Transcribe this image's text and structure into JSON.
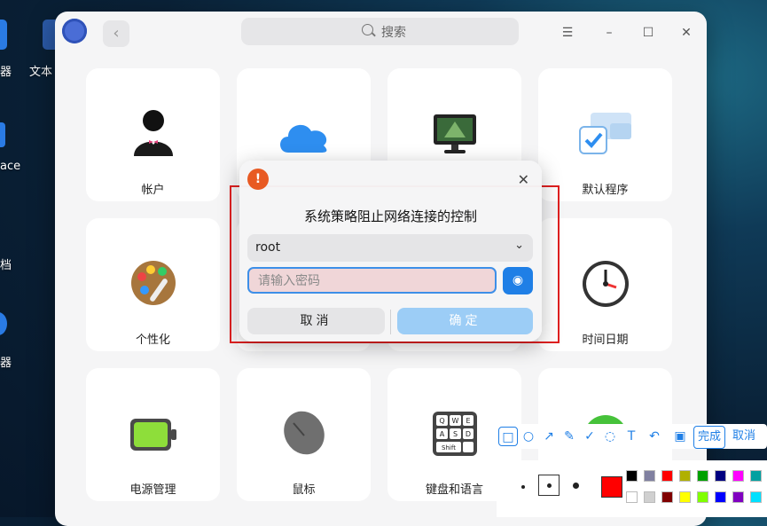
{
  "desktop": {
    "labels": [
      "器",
      "文本",
      "ace",
      "档",
      "器"
    ]
  },
  "window": {
    "search_placeholder": "搜索",
    "tiles": [
      {
        "label": "帐户",
        "icon": "account-icon"
      },
      {
        "label": "",
        "icon": "cloud-icon"
      },
      {
        "label": "",
        "icon": "display-icon"
      },
      {
        "label": "默认程序",
        "icon": "default-apps-icon"
      },
      {
        "label": "个性化",
        "icon": "palette-icon"
      },
      {
        "label": "",
        "icon": "network-icon"
      },
      {
        "label": "",
        "icon": "notification-icon"
      },
      {
        "label": "时间日期",
        "icon": "clock-icon"
      },
      {
        "label": "电源管理",
        "icon": "battery-icon"
      },
      {
        "label": "鼠标",
        "icon": "mouse-icon"
      },
      {
        "label": "键盘和语言",
        "icon": "keyboard-icon"
      },
      {
        "label": "",
        "icon": "globe-icon"
      }
    ],
    "keyboard_keys": [
      "Q",
      "W",
      "E",
      "A",
      "S",
      "D",
      "Shift"
    ]
  },
  "dialog": {
    "title": "系统策略阻止网络连接的控制",
    "user": "root",
    "password_placeholder": "请输入密码",
    "cancel_label": "取消",
    "ok_label": "确定"
  },
  "screenshot_toolbar": {
    "done_label": "完成",
    "cancel_label": "取消",
    "tools": [
      "rectangle-icon",
      "ellipse-icon",
      "arrow-icon",
      "pen-icon",
      "marker-icon",
      "blur-icon",
      "text-icon",
      "undo-icon",
      "save-icon"
    ],
    "selected_color": "#ff0000",
    "colors_row1": [
      "#000000",
      "#8080a0",
      "#ff0000",
      "#b0b000",
      "#00a000",
      "#000080",
      "#ff00ff",
      "#00a0a0"
    ],
    "colors_row2": [
      "#ffffff",
      "#d0d0d0",
      "#800000",
      "#ffff00",
      "#80ff00",
      "#0000ff",
      "#8000c0",
      "#00e0ff"
    ]
  }
}
